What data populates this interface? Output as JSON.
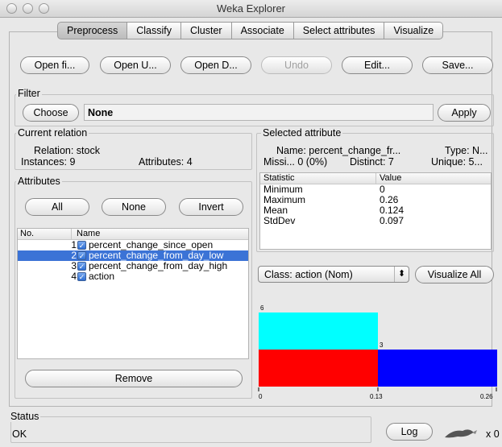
{
  "window": {
    "title": "Weka Explorer"
  },
  "tabs": [
    "Preprocess",
    "Classify",
    "Cluster",
    "Associate",
    "Select attributes",
    "Visualize"
  ],
  "toolbar": {
    "open_file": "Open fi...",
    "open_url": "Open U...",
    "open_db": "Open D...",
    "undo": "Undo",
    "edit": "Edit...",
    "save": "Save..."
  },
  "filter": {
    "title": "Filter",
    "choose": "Choose",
    "value": "None",
    "apply": "Apply"
  },
  "current_relation": {
    "title": "Current relation",
    "relation": "Relation: stock",
    "instances": "Instances: 9",
    "attributes": "Attributes: 4"
  },
  "attributes_panel": {
    "title": "Attributes",
    "all": "All",
    "none": "None",
    "invert": "Invert",
    "col_no": "No.",
    "col_name": "Name",
    "rows": [
      {
        "no": "1",
        "name": "percent_change_since_open",
        "checked": true,
        "selected": false
      },
      {
        "no": "2",
        "name": "percent_change_from_day_low",
        "checked": true,
        "selected": true
      },
      {
        "no": "3",
        "name": "percent_change_from_day_high",
        "checked": true,
        "selected": false
      },
      {
        "no": "4",
        "name": "action",
        "checked": true,
        "selected": false
      }
    ],
    "remove": "Remove"
  },
  "selected_attribute": {
    "title": "Selected attribute",
    "name": "Name: percent_change_fr...",
    "type": "Type: N...",
    "missing": "Missi... 0 (0%)",
    "distinct": "Distinct: 7",
    "unique": "Unique: 5...",
    "col_stat": "Statistic",
    "col_value": "Value",
    "stats": [
      {
        "stat": "Minimum",
        "value": "0"
      },
      {
        "stat": "Maximum",
        "value": "0.26"
      },
      {
        "stat": "Mean",
        "value": "0.124"
      },
      {
        "stat": "StdDev",
        "value": "0.097"
      }
    ]
  },
  "class_select": {
    "value": "Class: action (Nom)",
    "arrow": "⬍"
  },
  "visualize_all": "Visualize All",
  "histogram": {
    "bins": [
      {
        "from": 0,
        "to": 0.13,
        "total": 6,
        "segments": [
          {
            "count": 3,
            "color": "#ff0000"
          },
          {
            "count": 3,
            "color": "#00ffff"
          }
        ]
      },
      {
        "from": 0.13,
        "to": 0.26,
        "total": 3,
        "segments": [
          {
            "count": 3,
            "color": "#0000ff"
          }
        ]
      }
    ],
    "count_labels": [
      "6",
      "3"
    ],
    "axis_labels": [
      "0",
      "0.13",
      "0.26"
    ]
  },
  "status": {
    "title": "Status",
    "text": "OK",
    "log": "Log",
    "count": "x 0"
  },
  "colors": {
    "selection": "#3b73d6"
  }
}
